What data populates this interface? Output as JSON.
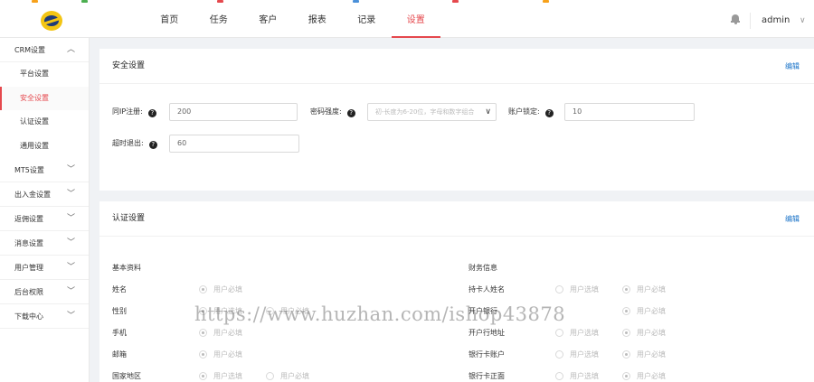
{
  "header": {
    "nav": [
      "首页",
      "任务",
      "客户",
      "报表",
      "记录",
      "设置"
    ],
    "active_nav": 5,
    "user": "admin",
    "strip_colors": [
      "#f7a11a",
      "#4caf50",
      "#e5484d",
      "#4a90d9",
      "#e5484d",
      "#f7a11a"
    ]
  },
  "sidebar": {
    "crm_label": "CRM设置",
    "crm_items": [
      "平台设置",
      "安全设置",
      "认证设置",
      "通用设置"
    ],
    "active_item": 1,
    "groups": [
      "MT5设置",
      "出入金设置",
      "返佣设置",
      "消息设置",
      "用户管理",
      "后台权限",
      "下载中心"
    ]
  },
  "security": {
    "title": "安全设置",
    "edit": "编辑",
    "same_ip_label": "同IP注册:",
    "same_ip_value": "200",
    "pwd_label": "密码强度:",
    "pwd_placeholder": "初-长度为6-20位，字母和数字组合",
    "lock_label": "账户锁定:",
    "lock_value": "10",
    "timeout_label": "超时退出:",
    "timeout_value": "60"
  },
  "auth": {
    "title": "认证设置",
    "edit": "编辑",
    "basic_title": "基本资料",
    "finance_title": "财务信息",
    "opt_optional": "用户选填",
    "opt_required": "用户必填",
    "basic_rows": [
      "姓名",
      "性别",
      "手机",
      "邮箱",
      "国家地区"
    ],
    "finance_rows": [
      "持卡人姓名",
      "开户银行",
      "开户行地址",
      "银行卡账户",
      "银行卡正面"
    ]
  },
  "watermark": "https://www.huzhan.com/ishop43878",
  "colors": {
    "accent": "#e5484d",
    "link": "#1a73c8"
  }
}
